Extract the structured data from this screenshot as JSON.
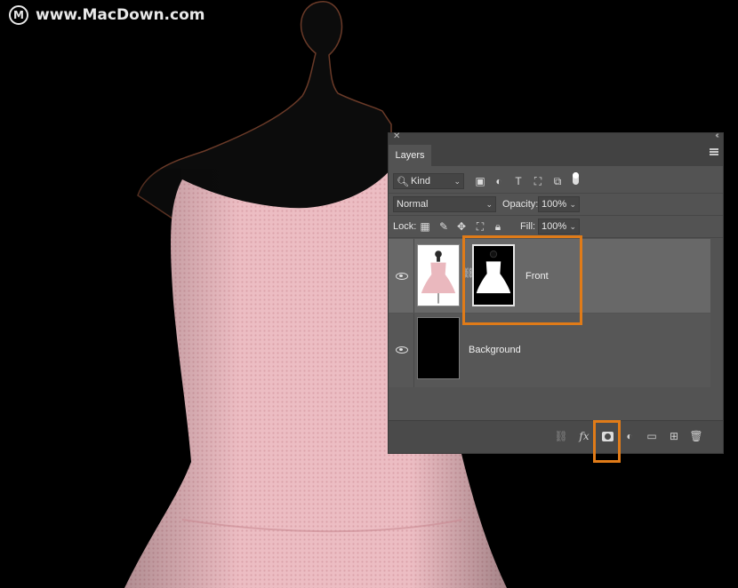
{
  "watermark": {
    "logo": "M",
    "text": "www.MacDown.com"
  },
  "panel": {
    "title": "Layers",
    "filter": {
      "kind_label": "Kind",
      "icons": [
        "image-filter-icon",
        "adjustment-filter-icon",
        "type-filter-icon",
        "shape-filter-icon",
        "smart-object-filter-icon",
        "filter-toggle-icon"
      ]
    },
    "blend_mode": "Normal",
    "opacity_label": "Opacity:",
    "opacity_value": "100%",
    "lock_label": "Lock:",
    "fill_label": "Fill:",
    "fill_value": "100%",
    "layers": [
      {
        "name": "Front",
        "visible": true,
        "selected": true,
        "has_mask": true
      },
      {
        "name": "Background",
        "visible": true,
        "selected": false,
        "has_mask": false
      }
    ],
    "bottom_icons": [
      "link-layers-icon",
      "fx-icon",
      "add-mask-icon",
      "adjustment-layer-icon",
      "new-group-icon",
      "new-layer-icon",
      "delete-icon"
    ]
  },
  "colors": {
    "highlight": "#e07b18",
    "dress": "#eab8be",
    "panel_bg": "#535353"
  }
}
